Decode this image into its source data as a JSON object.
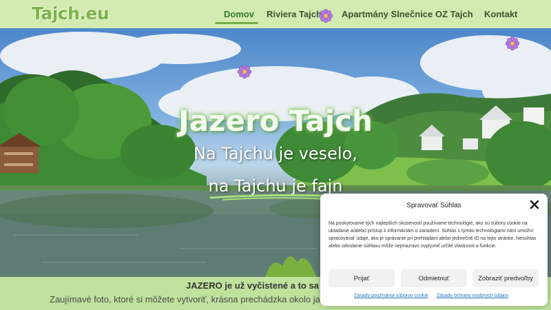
{
  "header": {
    "logo": "Tajch.eu",
    "nav": [
      {
        "label": "Domov",
        "active": true
      },
      {
        "label": "Riviera Tajch",
        "active": false
      },
      {
        "label": "Apartmány Slnečnice",
        "active": false
      },
      {
        "label": "OZ Tajch",
        "active": false
      },
      {
        "label": "Kontakt",
        "active": false
      }
    ]
  },
  "hero": {
    "title": "Jazero Tajch",
    "subtitle_1": "Na Tajchu je veselo,",
    "subtitle_2": "na Tajchu je fajn"
  },
  "band": {
    "line1": "JAZERO je už vyčistené a to sa lep",
    "line2": "Zaujímavé foto, ktoré si môžete vytvoriť, krásna prechádzka okolo jazer"
  },
  "consent": {
    "title": "Spravovať Súhlas",
    "body": "Na poskytovanie tých najlepších skúseností používame technológie, ako sú súbory cookie na ukladanie a/alebo prístup k informáciám o zariadení. Súhlas s týmito technológiami nám umožní spracovávať údaje, ako je správanie pri prehliadaní alebo jedinečné ID na tejto stránke. Nesúhlas alebo odvolanie súhlasu môže nepriaznivo ovplyvniť určité vlastnosti a funkcie.",
    "accept": "Prijať",
    "reject": "Odmietnuť",
    "preferences": "Zobraziť predvoľby",
    "cookie_policy": "Zásady používania súborov cookie",
    "privacy_policy": "Zásady ochrany osobných údajov"
  },
  "colors": {
    "header_bg": "#d3ebb1",
    "accent_green": "#74ad4b",
    "band_bg": "#bfe29d",
    "flower": "#b57de0"
  },
  "icons": [
    "flower-icon",
    "close-icon"
  ]
}
